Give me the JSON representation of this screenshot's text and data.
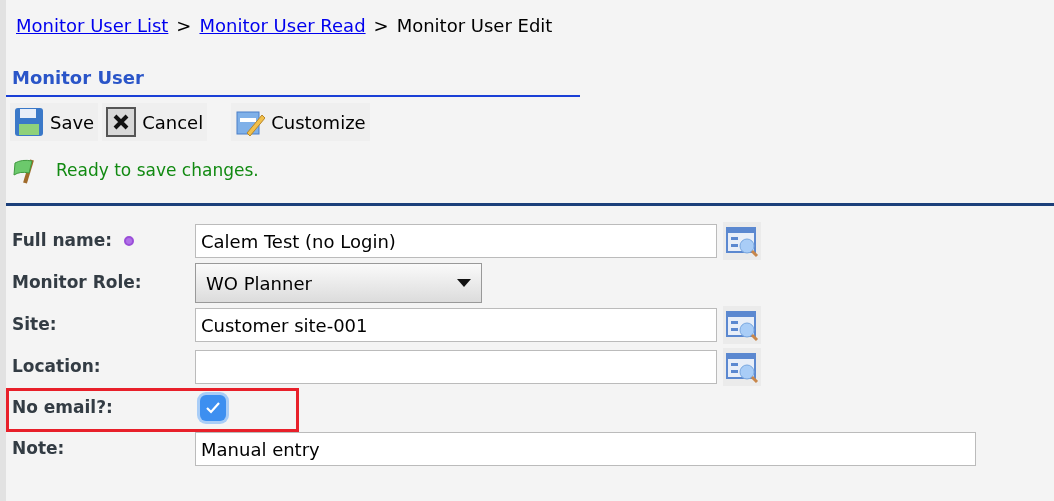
{
  "breadcrumb": [
    {
      "label": "Monitor User List",
      "link": true
    },
    {
      "label": "Monitor User Read",
      "link": true
    },
    {
      "label": "Monitor User Edit",
      "link": false
    }
  ],
  "breadcrumb_separator": ">",
  "form_title": "Monitor User",
  "toolbar": [
    {
      "label": "Save",
      "kind": "save"
    },
    {
      "label": "Cancel",
      "kind": "cancel"
    },
    {
      "label": "Customize",
      "kind": "customize"
    }
  ],
  "status_message": "Ready to save changes.",
  "fields": [
    {
      "label": "Full name:",
      "kind": "text",
      "value": "Calem Test (no Login)",
      "required": true,
      "lookup": true,
      "highlighted": false
    },
    {
      "label": "Monitor Role:",
      "kind": "select",
      "value": "WO Planner",
      "required": false,
      "lookup": false,
      "highlighted": false
    },
    {
      "label": "Site:",
      "kind": "text",
      "value": "Customer site-001",
      "required": false,
      "lookup": true,
      "highlighted": false
    },
    {
      "label": "Location:",
      "kind": "text",
      "required": false,
      "lookup": true,
      "highlighted": false
    },
    {
      "label": "No email?:",
      "kind": "checkbox",
      "checked": true,
      "required": false,
      "lookup": false,
      "highlighted": true
    },
    {
      "label": "Note:",
      "kind": "wide_text",
      "value": "Manual entry",
      "required": false,
      "lookup": false,
      "highlighted": false
    }
  ]
}
